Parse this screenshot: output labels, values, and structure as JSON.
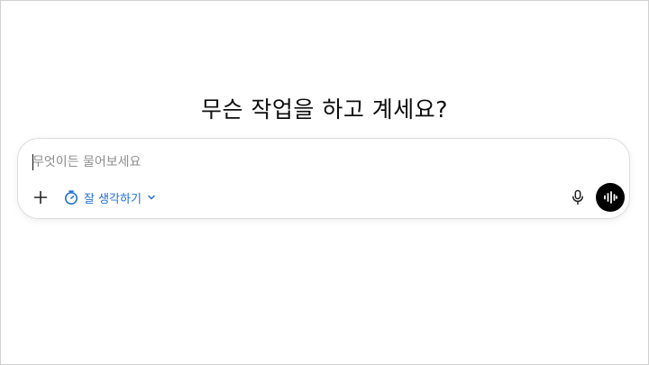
{
  "main": {
    "headline": "무슨 작업을 하고 계세요?"
  },
  "composer": {
    "placeholder": "무엇이든 물어보세요",
    "value": "",
    "add_icon": "plus-icon",
    "think_button": {
      "icon": "timer-icon",
      "label": "잘 생각하기",
      "chevron": "chevron-down-icon"
    },
    "mic_icon": "microphone-icon",
    "voice_icon": "voice-waveform-icon"
  },
  "colors": {
    "accent": "#1f6fd8",
    "voice_button_bg": "#000000",
    "placeholder": "#8e8e8e"
  }
}
